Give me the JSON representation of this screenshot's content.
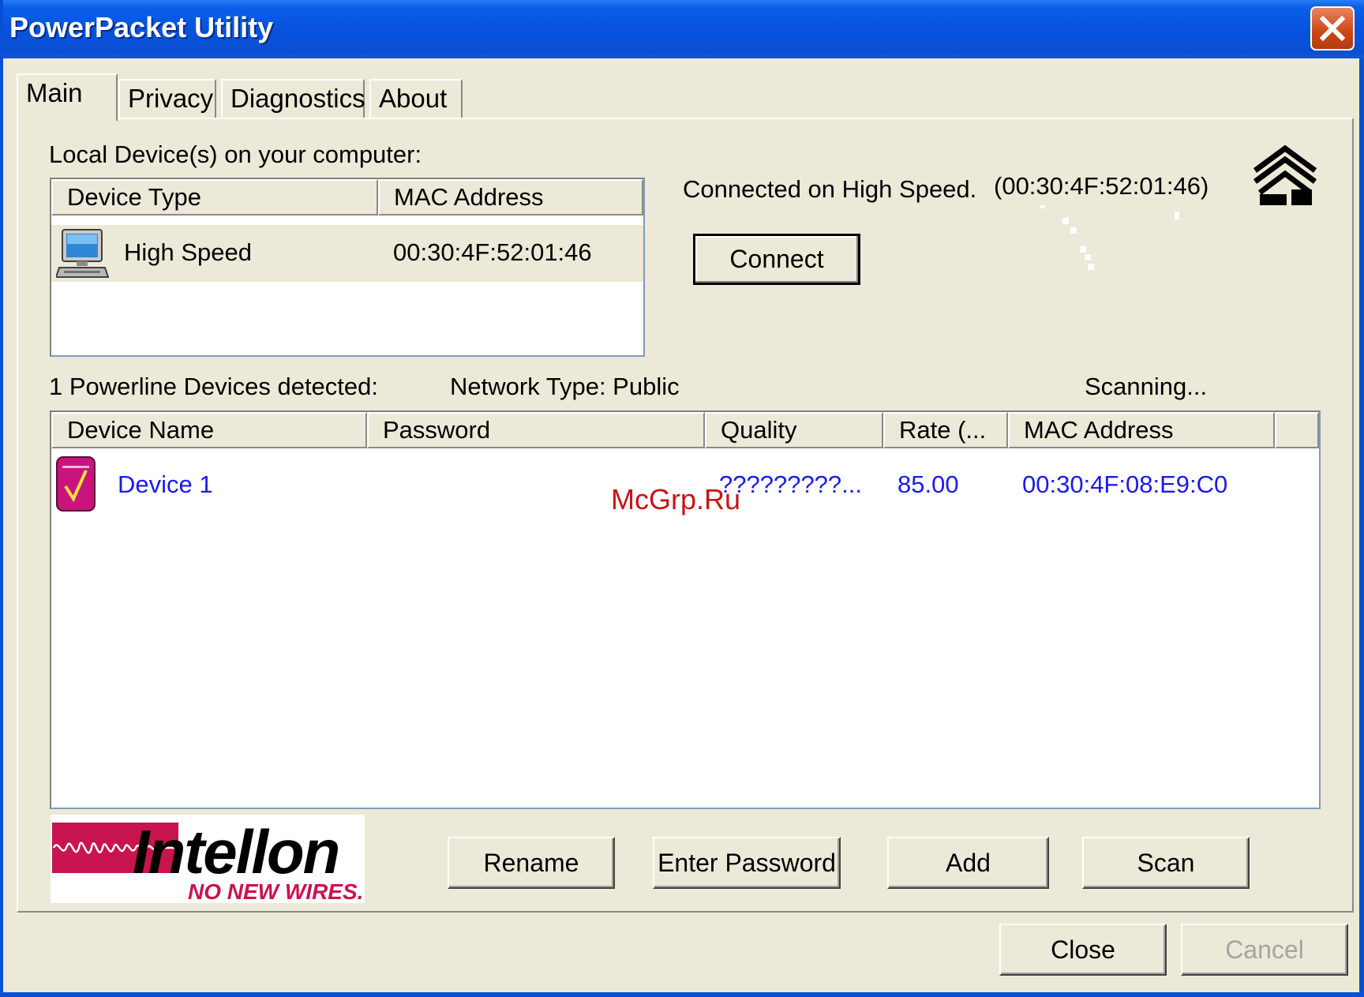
{
  "window": {
    "title": "PowerPacket Utility"
  },
  "tabs": [
    "Main",
    "Privacy",
    "Diagnostics",
    "About"
  ],
  "local": {
    "label": "Local Device(s) on your computer:",
    "columns": [
      "Device Type",
      "MAC Address"
    ],
    "rows": [
      {
        "type": "High Speed",
        "mac": "00:30:4F:52:01:46",
        "icon": "computer-icon"
      }
    ]
  },
  "status": {
    "connected_text": "Connected on  High Speed.",
    "connected_mac": "(00:30:4F:52:01:46)",
    "connect_label": "Connect",
    "icon": "house-icon"
  },
  "network": {
    "detected": "1 Powerline Devices detected:",
    "type": "Network Type: Public",
    "scanning": "Scanning...",
    "columns": [
      "Device Name",
      "Password",
      "Quality",
      "Rate (...",
      "MAC Address"
    ],
    "rows": [
      {
        "name": "Device 1",
        "password": "",
        "quality": "?????????...",
        "rate": "85.00",
        "mac": "00:30:4F:08:E9:C0",
        "icon": "powerline-device-icon"
      }
    ]
  },
  "watermark": "McGrp.Ru",
  "logo": {
    "brand": "Intellon",
    "tagline": "NO NEW WIRES."
  },
  "buttons": {
    "rename": "Rename",
    "enter_password": "Enter Password",
    "add": "Add",
    "scan": "Scan",
    "close": "Close",
    "cancel": "Cancel"
  },
  "colors": {
    "title_bar": "#0752dc",
    "window_bg": "#ece9d8",
    "link_text": "#1a1af0",
    "close_button": "#cc4516",
    "logo_accent": "#c8144f",
    "watermark": "#c81414"
  }
}
